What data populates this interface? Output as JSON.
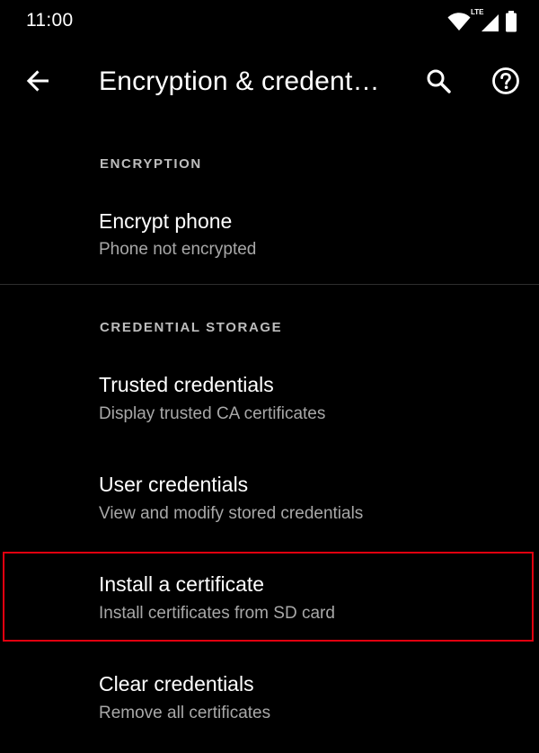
{
  "status_bar": {
    "time": "11:00",
    "network_label": "LTE",
    "icons": [
      "wifi-icon",
      "signal-icon",
      "battery-icon"
    ]
  },
  "app_bar": {
    "title": "Encryption & credent…",
    "icons": [
      "back-arrow-icon",
      "search-icon",
      "help-icon"
    ]
  },
  "sections": [
    {
      "header": "ENCRYPTION",
      "items": [
        {
          "title": "Encrypt phone",
          "summary": "Phone not encrypted"
        }
      ]
    },
    {
      "header": "CREDENTIAL STORAGE",
      "items": [
        {
          "title": "Trusted credentials",
          "summary": "Display trusted CA certificates"
        },
        {
          "title": "User credentials",
          "summary": "View and modify stored credentials"
        },
        {
          "title": "Install a certificate",
          "summary": "Install certificates from SD card"
        },
        {
          "title": "Clear credentials",
          "summary": "Remove all certificates"
        }
      ]
    }
  ],
  "colors": {
    "background": "#000000",
    "primary_text": "#ffffff",
    "secondary_text": "#a8a8a8",
    "section_header": "#bdbdbd",
    "highlight": "#e1000f"
  }
}
